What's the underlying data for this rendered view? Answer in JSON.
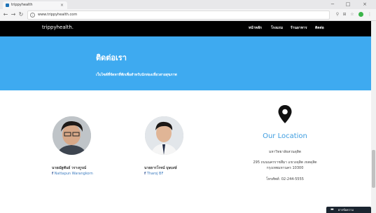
{
  "browser": {
    "tab_title": "trippyhealth",
    "tab_close": "×",
    "url": "www.trippyhealth.com",
    "window_controls": {
      "minimize": "−",
      "maximize": "□",
      "close": "×"
    }
  },
  "site": {
    "brand": "trippyhealth.",
    "menu": [
      "หน้าหลัก",
      "โรงแรม",
      "ร้านอาหาร",
      "ติดต่อ"
    ]
  },
  "hero": {
    "title": "ติดต่อเรา",
    "subtitle": "เว็บไซต์ที่จัดหาที่พักเพื่อสำหรับนักท่องเที่ยวสายสุขภาพ",
    "background": "#3eaaf0"
  },
  "team": [
    {
      "name": "นายณัฐพันธ์ วรางกูรณ์",
      "facebook": "Nattapun Warangkorn"
    },
    {
      "name": "นายธารโรจน์ บุษบงษ์",
      "facebook": "Tharoj BF"
    }
  ],
  "location": {
    "title": "Our Location",
    "university": "มหาวิทยาลัยสวนดุสิต",
    "address_line1": "295 ถนนนครราชสีมา แขวงดุสิต เขตดุสิต",
    "address_line2": "กรุงเทพมหานคร 10300",
    "phone": "โทรศัพท์: 02-244-5555",
    "accent": "#3e9de0"
  },
  "chat": {
    "label": "ฝากข้อความ"
  }
}
